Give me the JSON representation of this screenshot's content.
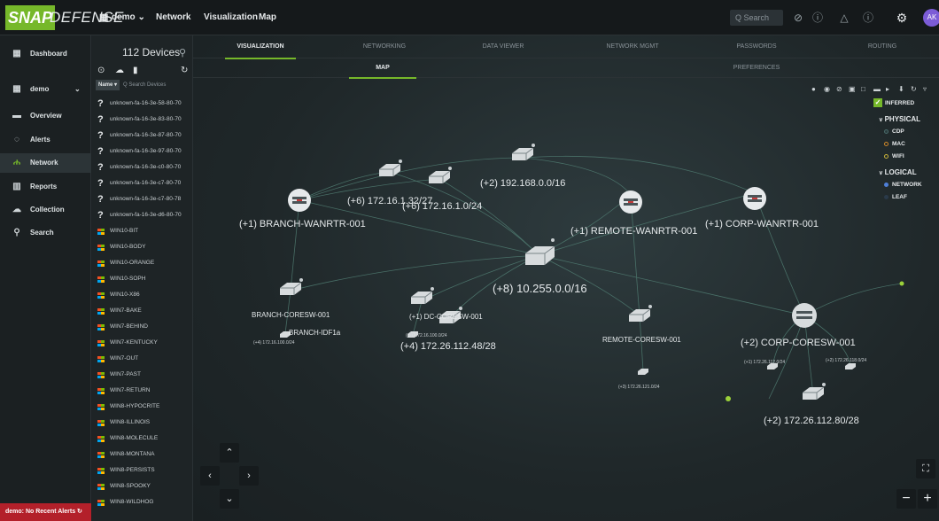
{
  "app": {
    "logo_snap": "SNAP",
    "logo_defense": "DEFENSE"
  },
  "topbar": {
    "org": "demo",
    "nav": [
      "Network",
      "Visualization",
      "Map"
    ],
    "search_placeholder": "Q Search",
    "avatar": "AK"
  },
  "leftnav": {
    "items": [
      "Dashboard",
      "demo",
      "Overview",
      "Alerts",
      "Network",
      "Reports",
      "Collection",
      "Search"
    ],
    "alert_status": "demo: No Recent Alerts"
  },
  "devices": {
    "count_label": "112 Devices",
    "search_name_btn": "Name",
    "search_placeholder": "Q Search Devices",
    "unknown": [
      "unknown-fa-16-3e-58-80-70",
      "unknown-fa-16-3e-83-80-70",
      "unknown-fa-16-3e-87-80-70",
      "unknown-fa-16-3e-97-80-70",
      "unknown-fa-16-3e-c0-80-70",
      "unknown-fa-16-3e-c7-80-70",
      "unknown-fa-16-3e-c7-80-78",
      "unknown-fa-16-3e-d6-80-70"
    ],
    "windows": [
      "WIN10-BIT",
      "WIN10-BODY",
      "WIN10-ORANGE",
      "WIN10-SOPH",
      "WIN10-X86",
      "WIN7-BAKE",
      "WIN7-BEHIND",
      "WIN7-KENTUCKY",
      "WIN7-OUT",
      "WIN7-PAST",
      "WIN7-RETURN",
      "WIN8-HYPOCRITE",
      "WIN8-ILLINOIS",
      "WIN8-MOLECULE",
      "WIN8-MONTANA",
      "WIN8-PERSISTS",
      "WIN8-SPOOKY",
      "WIN8-WILDHOG"
    ]
  },
  "tabs": [
    "VISUALIZATION",
    "NETWORKING",
    "DATA VIEWER",
    "NETWORK MGMT",
    "PASSWORDS",
    "ROUTING"
  ],
  "subtabs": [
    "MAP",
    "PREFERENCES"
  ],
  "legend": {
    "inferred": "INFERRED",
    "physical": "PHYSICAL",
    "cdp": "CDP",
    "mac": "MAC",
    "wifi": "WIFI",
    "logical": "LOGICAL",
    "network": "NETWORK",
    "leaf": "LEAF"
  },
  "map": {
    "labels": {
      "branch_wanrtr": "(+1) BRANCH-WANRTR-001",
      "subnet_172_16_1_32": "(+6) 172.16.1.32/27",
      "subnet_172_16_1_0": "(+6) 172.16.1.0/24",
      "subnet_192_168": "(+2) 192.168.0.0/16",
      "remote_wanrtr": "(+1) REMOTE-WANRTR-001",
      "corp_wanrtr": "(+1) CORP-WANRTR-001",
      "core_subnet": "(+8) 10.255.0.0/16",
      "branch_coresw": "BRANCH-CORESW-001",
      "branch_idf": "BRANCH-IDF1a",
      "branch_idf_sub": "(+4) 172.16.100.0/24",
      "dc_coresw": "(+1) DC-CORESW-001",
      "dc_sub": "(+1) 172.16.100.0/24",
      "subnet_172_26_112_48": "(+4) 172.26.112.48/28",
      "remote_coresw": "REMOTE-CORESW-001",
      "remote_sub": "(+3) 172.26.121.0/24",
      "corp_coresw": "(+2) CORP-CORESW-001",
      "corp_sub_a": "(+1) 172.26.112.0/24",
      "corp_sub_b": "(+2) 172.26.118.0/24",
      "subnet_172_26_112_80": "(+2) 172.26.112.80/28"
    }
  },
  "colors": {
    "accent": "#76b82a",
    "alert": "#b3202a",
    "background": "#1d2224"
  }
}
